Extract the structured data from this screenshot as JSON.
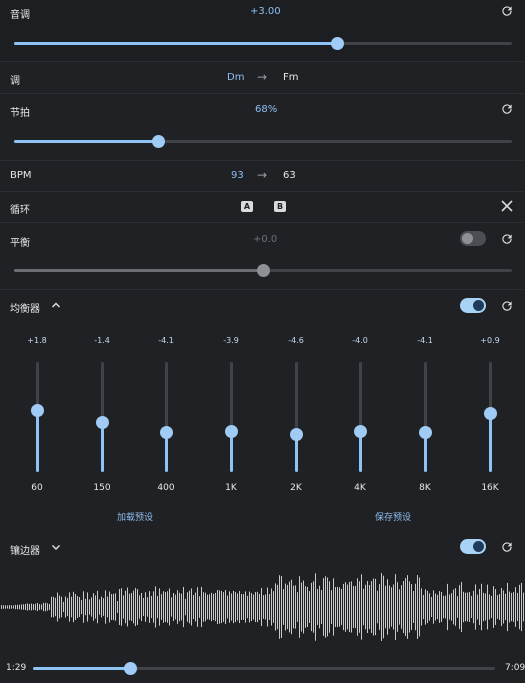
{
  "pitch": {
    "label": "音调",
    "value": "+3.00",
    "level": 0.65
  },
  "key": {
    "label": "调",
    "from": "Dm",
    "arrow": "→",
    "to": "Fm"
  },
  "tempo": {
    "label": "节拍",
    "value": "68%",
    "level": 0.29
  },
  "bpm": {
    "label": "BPM",
    "from": "93",
    "arrow": "→",
    "to": "63"
  },
  "loop": {
    "label": "循环",
    "a": "A",
    "b": "B"
  },
  "balance": {
    "label": "平衡",
    "value": "+0.0",
    "level": 0.5,
    "enabled": false
  },
  "equalizer": {
    "label": "均衡器",
    "enabled": true,
    "bands": [
      {
        "value": "+1.8",
        "freq": "60",
        "level": 0.56
      },
      {
        "value": "-1.4",
        "freq": "150",
        "level": 0.45
      },
      {
        "value": "-4.1",
        "freq": "400",
        "level": 0.36
      },
      {
        "value": "-3.9",
        "freq": "1K",
        "level": 0.37
      },
      {
        "value": "-4.6",
        "freq": "2K",
        "level": 0.34
      },
      {
        "value": "-4.0",
        "freq": "4K",
        "level": 0.37
      },
      {
        "value": "-4.1",
        "freq": "8K",
        "level": 0.36
      },
      {
        "value": "+0.9",
        "freq": "16K",
        "level": 0.53
      }
    ],
    "load_preset": "加载预设",
    "save_preset": "保存预设"
  },
  "trimmer": {
    "label": "镶边器",
    "enabled": true
  },
  "playback": {
    "current": "1:29",
    "total": "7:09",
    "progress": 0.21
  },
  "colors": {
    "accent": "#8fc3f3",
    "background": "#1f2125",
    "waveform": "#c8cacd"
  },
  "icons": {
    "reset": "refresh-icon",
    "close": "close-icon",
    "chevron_up": "chevron-up-icon",
    "chevron_down": "chevron-down-icon"
  }
}
